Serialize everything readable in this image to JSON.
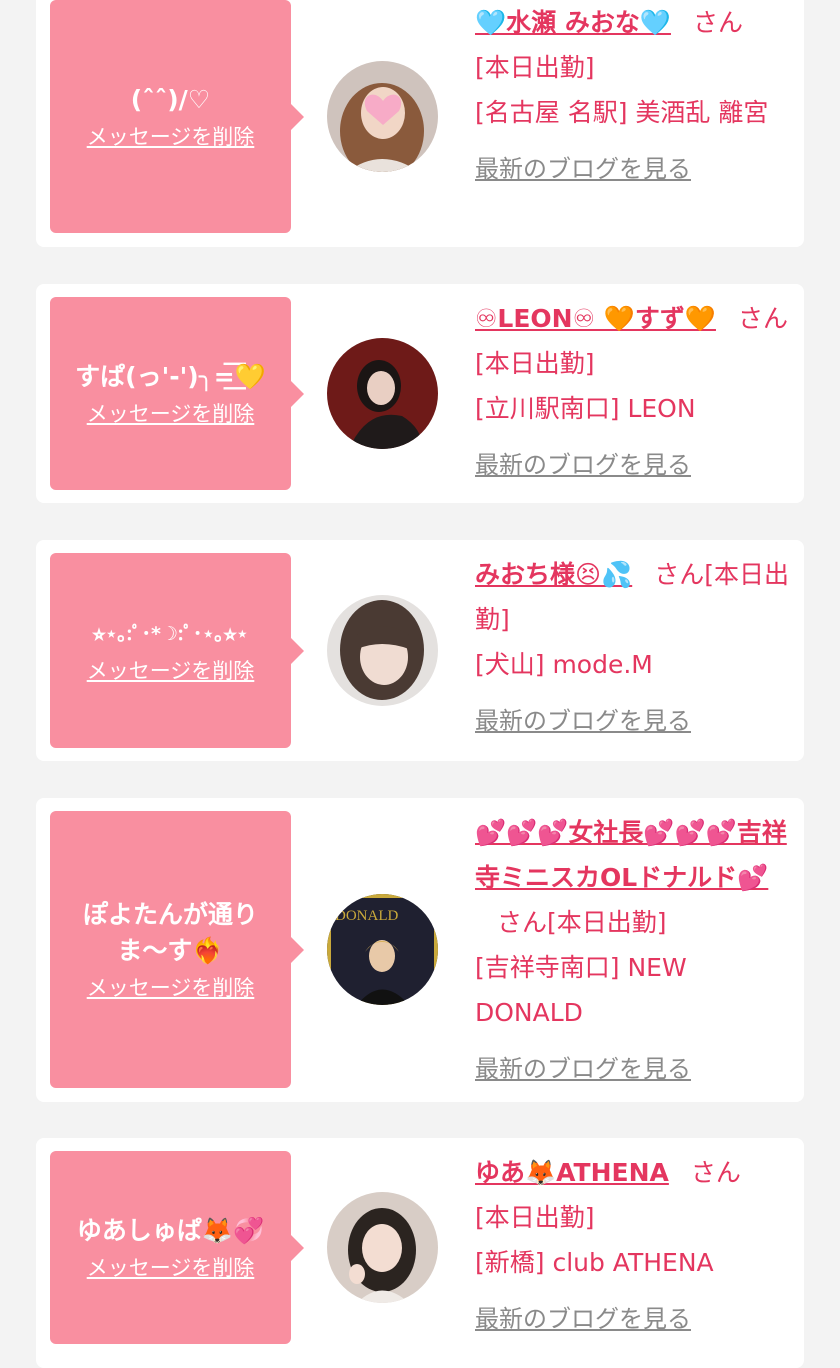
{
  "delete_label": "メッセージを削除",
  "blog_label": "最新のブログを見る",
  "san": "さん",
  "cards": [
    {
      "message": "(ˆˆ)/♡",
      "name": "🩵水瀬 みおな🩵",
      "status": "[本日出勤]",
      "location": "[名古屋 名駅] 美酒乱 離宮"
    },
    {
      "message": "すぱ(っ'-')╮=͟͟͞͞💛",
      "name": "♾LEON♾ 🧡すず🧡",
      "status": "[本日出勤]",
      "location": "[立川駅南口] LEON"
    },
    {
      "message": "⭐︎⋆｡:ﾟ･*☽:ﾟ･⋆｡⭐︎⋆",
      "name": "みおち様😣💦",
      "status": "[本日出勤]",
      "location": "[犬山] mode.M"
    },
    {
      "message": "ぽよたんが通りま〜す❤️‍🔥",
      "name": "💕💕💕女社長💕💕💕吉祥寺ミニスカOLドナルド💕",
      "status": "[本日出勤]",
      "location": "[吉祥寺南口] NEW DONALD"
    },
    {
      "message": "ゆあしゅぱ🦊💞",
      "name": "ゆあ🦊ATHENA",
      "status": "[本日出勤]",
      "location": "[新橋] club ATHENA"
    }
  ]
}
